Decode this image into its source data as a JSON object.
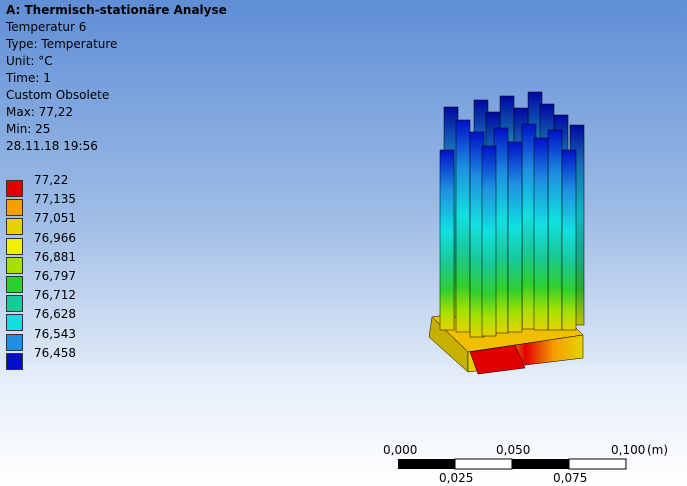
{
  "info": {
    "title": "A: Thermisch-stationäre Analyse",
    "result_name": "Temperatur 6",
    "type": "Type: Temperature",
    "unit": "Unit: °C",
    "time": "Time: 1",
    "custom": "Custom Obsolete",
    "max": "Max: 77,22",
    "min": "Min: 25",
    "timestamp": "28.11.18 19:56"
  },
  "legend": [
    {
      "label": "77,22",
      "color": "#e00000"
    },
    {
      "label": "77,135",
      "color": "#f5a000"
    },
    {
      "label": "77,051",
      "color": "#e6d200"
    },
    {
      "label": "76,966",
      "color": "#f0f000"
    },
    {
      "label": "76,881",
      "color": "#a6e000"
    },
    {
      "label": "76,797",
      "color": "#2fcf2f"
    },
    {
      "label": "76,712",
      "color": "#18c99a"
    },
    {
      "label": "76,628",
      "color": "#12e0e0"
    },
    {
      "label": "76,543",
      "color": "#1e8fe0"
    },
    {
      "label": "76,458",
      "color": "#0010c8"
    }
  ],
  "scale_bar": {
    "top_labels": [
      "0,000",
      "0,050",
      "0,100"
    ],
    "bottom_labels": [
      "0,025",
      "0,075"
    ],
    "unit": "(m)"
  }
}
